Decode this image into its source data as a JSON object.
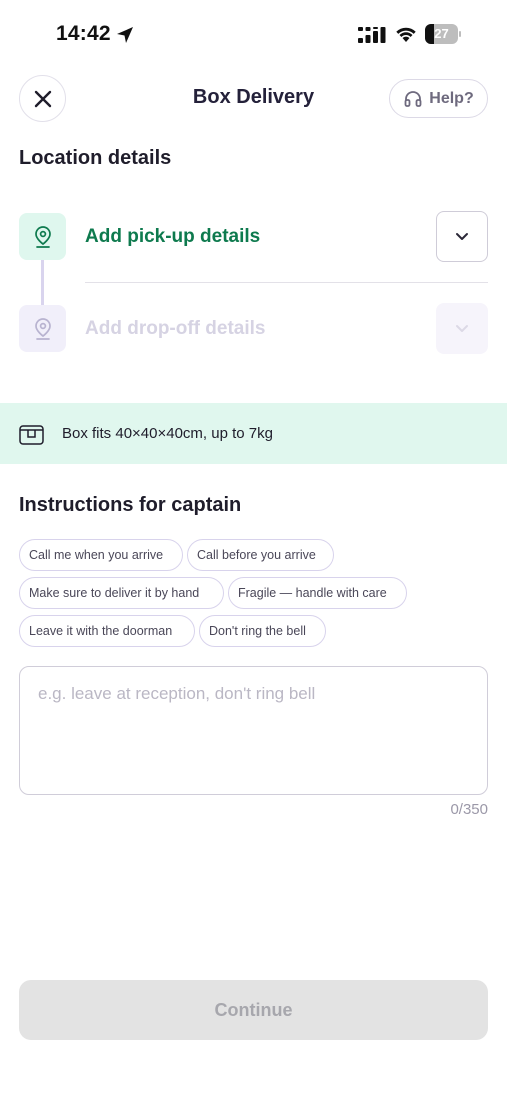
{
  "status_bar": {
    "time": "14:42",
    "battery_level": "27",
    "icons": [
      "location-arrow-icon",
      "signal-icon",
      "wifi-icon",
      "battery-icon"
    ]
  },
  "header": {
    "title": "Box Delivery",
    "close_icon": "close-icon",
    "help_label": "Help?",
    "help_icon": "headset-icon"
  },
  "location": {
    "heading": "Location details",
    "pickup": {
      "label": "Add pick-up details",
      "icon": "map-pin-icon",
      "color": "#0e7a4e"
    },
    "dropoff": {
      "label": "Add drop-off details",
      "icon": "map-pin-icon",
      "color": "#d6d3e3"
    }
  },
  "box_info": {
    "text": "Box fits 40×40×40cm, up to 7kg",
    "icon": "box-icon",
    "background": "#e0f7ee"
  },
  "instructions": {
    "heading": "Instructions for captain",
    "chips": [
      "Call me when you arrive",
      "Call before you arrive",
      "Make sure to deliver it by hand",
      "Fragile — handle with care",
      "Leave it with the doorman",
      "Don't ring the bell"
    ],
    "placeholder": "e.g. leave at reception, don't ring bell",
    "value": "",
    "counter": "0/350"
  },
  "footer": {
    "continue_label": "Continue",
    "continue_enabled": false
  }
}
